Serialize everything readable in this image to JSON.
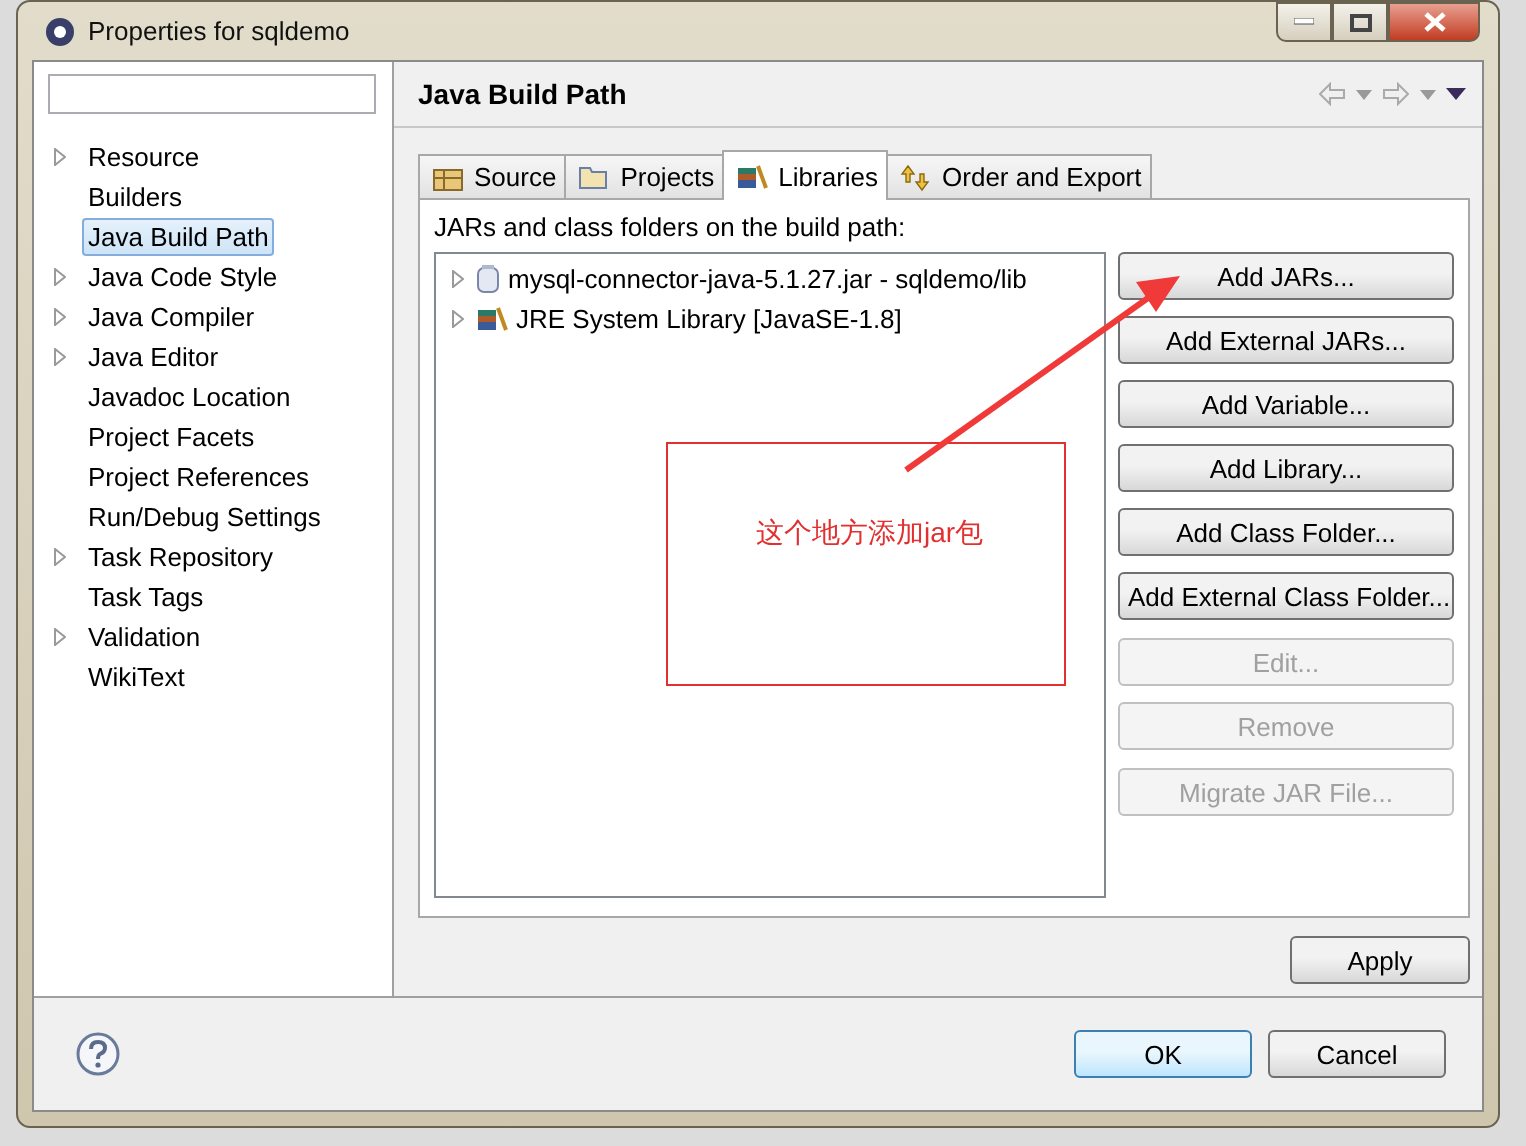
{
  "window": {
    "title": "Properties for sqldemo"
  },
  "sidebar": {
    "items": [
      {
        "label": "Resource",
        "expandable": true,
        "selected": false
      },
      {
        "label": "Builders",
        "expandable": false,
        "selected": false
      },
      {
        "label": "Java Build Path",
        "expandable": false,
        "selected": true
      },
      {
        "label": "Java Code Style",
        "expandable": true,
        "selected": false
      },
      {
        "label": "Java Compiler",
        "expandable": true,
        "selected": false
      },
      {
        "label": "Java Editor",
        "expandable": true,
        "selected": false
      },
      {
        "label": "Javadoc Location",
        "expandable": false,
        "selected": false
      },
      {
        "label": "Project Facets",
        "expandable": false,
        "selected": false
      },
      {
        "label": "Project References",
        "expandable": false,
        "selected": false
      },
      {
        "label": "Run/Debug Settings",
        "expandable": false,
        "selected": false
      },
      {
        "label": "Task Repository",
        "expandable": true,
        "selected": false
      },
      {
        "label": "Task Tags",
        "expandable": false,
        "selected": false
      },
      {
        "label": "Validation",
        "expandable": true,
        "selected": false
      },
      {
        "label": "WikiText",
        "expandable": false,
        "selected": false
      }
    ]
  },
  "page": {
    "title": "Java Build Path"
  },
  "tabs": [
    {
      "label": "Source",
      "kind": "source",
      "selected": false
    },
    {
      "label": "Projects",
      "kind": "projects",
      "selected": false
    },
    {
      "label": "Libraries",
      "kind": "libraries",
      "selected": true
    },
    {
      "label": "Order and Export",
      "kind": "order",
      "selected": false
    }
  ],
  "libraries": {
    "heading": "JARs and class folders on the build path:",
    "entries": [
      {
        "label": "mysql-connector-java-5.1.27.jar - sqldemo/lib",
        "kind": "jar"
      },
      {
        "label": "JRE System Library [JavaSE-1.8]",
        "kind": "jre"
      }
    ]
  },
  "button_groups": [
    [
      {
        "label": "Add JARs...",
        "disabled": false
      },
      {
        "label": "Add External JARs...",
        "disabled": false
      },
      {
        "label": "Add Variable...",
        "disabled": false
      },
      {
        "label": "Add Library...",
        "disabled": false
      },
      {
        "label": "Add Class Folder...",
        "disabled": false
      },
      {
        "label": "Add External Class Folder...",
        "disabled": false
      }
    ],
    [
      {
        "label": "Edit...",
        "disabled": true
      },
      {
        "label": "Remove",
        "disabled": true
      }
    ],
    [
      {
        "label": "Migrate JAR File...",
        "disabled": true
      }
    ]
  ],
  "annotation": {
    "text": "这个地方添加jar包"
  },
  "apply_button": "Apply",
  "dialog_buttons": [
    {
      "label": "OK",
      "default": true
    },
    {
      "label": "Cancel",
      "default": false
    }
  ]
}
